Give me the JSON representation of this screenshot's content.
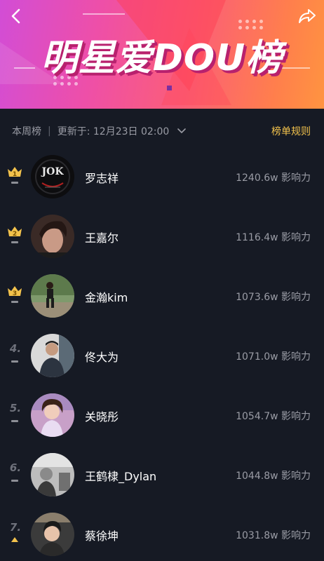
{
  "banner": {
    "title": "明星爱DOU榜",
    "back_icon": "chevron-left-icon",
    "share_icon": "share-arrow-icon"
  },
  "subheader": {
    "board": "本周榜",
    "divider": "|",
    "updated": "更新于: 12月23日 02:00",
    "rules": "榜单规则"
  },
  "colors": {
    "background": "#161a24",
    "accent_gold": "#f2c24c",
    "muted_text": "#9a9ca5"
  },
  "list": [
    {
      "rank": "1",
      "name": "罗志祥",
      "score": "1240.6w 影响力",
      "badge": "crown",
      "trend": "flat"
    },
    {
      "rank": "2",
      "name": "王嘉尔",
      "score": "1116.4w 影响力",
      "badge": "crown",
      "trend": "flat"
    },
    {
      "rank": "3",
      "name": "金瀚kim",
      "score": "1073.6w 影响力",
      "badge": "crown",
      "trend": "flat"
    },
    {
      "rank": "4.",
      "name": "佟大为",
      "score": "1071.0w 影响力",
      "badge": "number",
      "trend": "flat"
    },
    {
      "rank": "5.",
      "name": "关晓彤",
      "score": "1054.7w 影响力",
      "badge": "number",
      "trend": "flat"
    },
    {
      "rank": "6.",
      "name": "王鹤棣_Dylan",
      "score": "1044.8w 影响力",
      "badge": "number",
      "trend": "flat"
    },
    {
      "rank": "7.",
      "name": "蔡徐坤",
      "score": "1031.8w 影响力",
      "badge": "number",
      "trend": "up"
    }
  ]
}
